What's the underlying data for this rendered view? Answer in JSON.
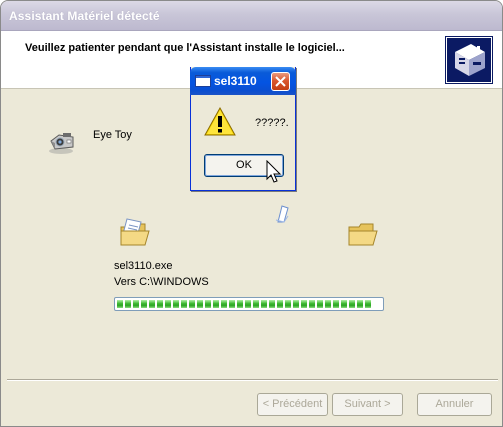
{
  "wizard": {
    "title": "Assistant Matériel détecté",
    "heading": "Veuillez patienter pendant que l'Assistant installe le logiciel...",
    "device_name": "Eye Toy",
    "copy": {
      "file_name": "sel3110.exe",
      "destination": "Vers C:\\WINDOWS",
      "progress_fraction": 0.98
    },
    "buttons": {
      "back": "< Précédent",
      "next": "Suivant >",
      "cancel": "Annuler"
    }
  },
  "message_box": {
    "title": "sel3110",
    "message": "?????.",
    "ok": "OK",
    "icon": "warning-icon"
  },
  "colors": {
    "title_inactive": "#c9c6d8",
    "title_active": "#0454e2",
    "progress": "#3cb830",
    "close": "#d9572e"
  }
}
